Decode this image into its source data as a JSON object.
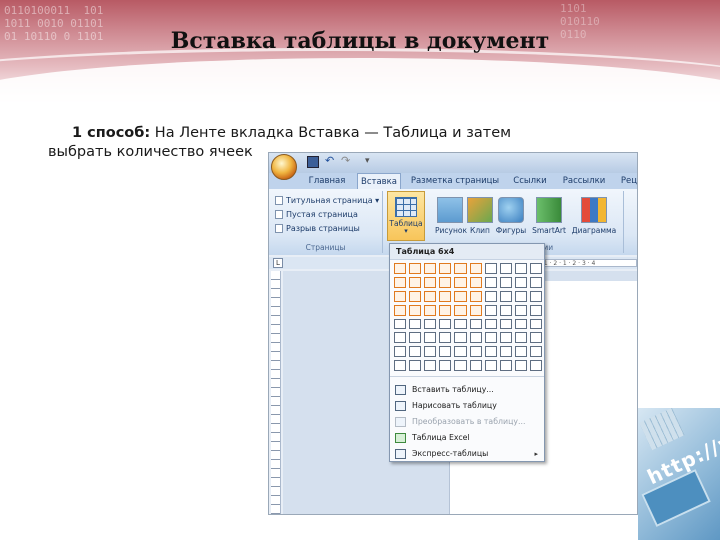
{
  "slide": {
    "title": "Вставка таблицы в документ",
    "method_label": "1 способ:",
    "method_text": " На Ленте вкладка Вставка — Таблица и затем",
    "method_text_cont": "выбрать количество ячеек",
    "banner_bits": "0110100011  101\n1011 0010 01101\n01 10110 0 1101",
    "banner_bits_right": "1101\n010110\n0110"
  },
  "word": {
    "quick_access": {
      "save_icon": "save-icon",
      "undo_glyph": "↶",
      "redo_glyph": "↷",
      "more_glyph": "▾"
    },
    "tabs": [
      "Главная",
      "Вставка",
      "Разметка страницы",
      "Ссылки",
      "Рассылки",
      "Рец"
    ],
    "active_tab": "Вставка",
    "groups": {
      "pages": {
        "items": [
          "Титульная страница ▾",
          "Пустая страница",
          "Разрыв страницы"
        ],
        "label": "Страницы"
      },
      "table_button": {
        "label": "Таблица",
        "arrow": "▾"
      },
      "illustrations": {
        "buttons": [
          "Рисунок",
          "Клип",
          "Фигуры",
          "SmartArt",
          "Диаграмма"
        ],
        "label": "Иллюстрации"
      }
    },
    "ruler_corner": "L",
    "ruler_ticks": "· 1 · 2 · 1 · 2 · 3 · 4",
    "table_menu": {
      "header": "Таблица 6x4",
      "grid_cols": 10,
      "grid_rows": 8,
      "selected_cols": 6,
      "selected_rows": 4,
      "items": [
        {
          "label": "Вставить таблицу...",
          "enabled": true,
          "submenu": false,
          "icon": "insert-table-icon"
        },
        {
          "label": "Нарисовать таблицу",
          "enabled": true,
          "submenu": false,
          "icon": "draw-table-icon"
        },
        {
          "label": "Преобразовать в таблицу...",
          "enabled": false,
          "submenu": false,
          "icon": "convert-table-icon"
        },
        {
          "label": "Таблица Excel",
          "enabled": true,
          "submenu": false,
          "icon": "excel-table-icon"
        },
        {
          "label": "Экспресс-таблицы",
          "enabled": true,
          "submenu": true,
          "icon": "quick-tables-icon"
        }
      ],
      "submenu_arrow": "▸"
    }
  },
  "decor": {
    "http_text": "http://w"
  },
  "colors": {
    "accent_selection": "#e07a1f",
    "banner": "#b85a64",
    "ribbon": "#dbe7f5"
  }
}
